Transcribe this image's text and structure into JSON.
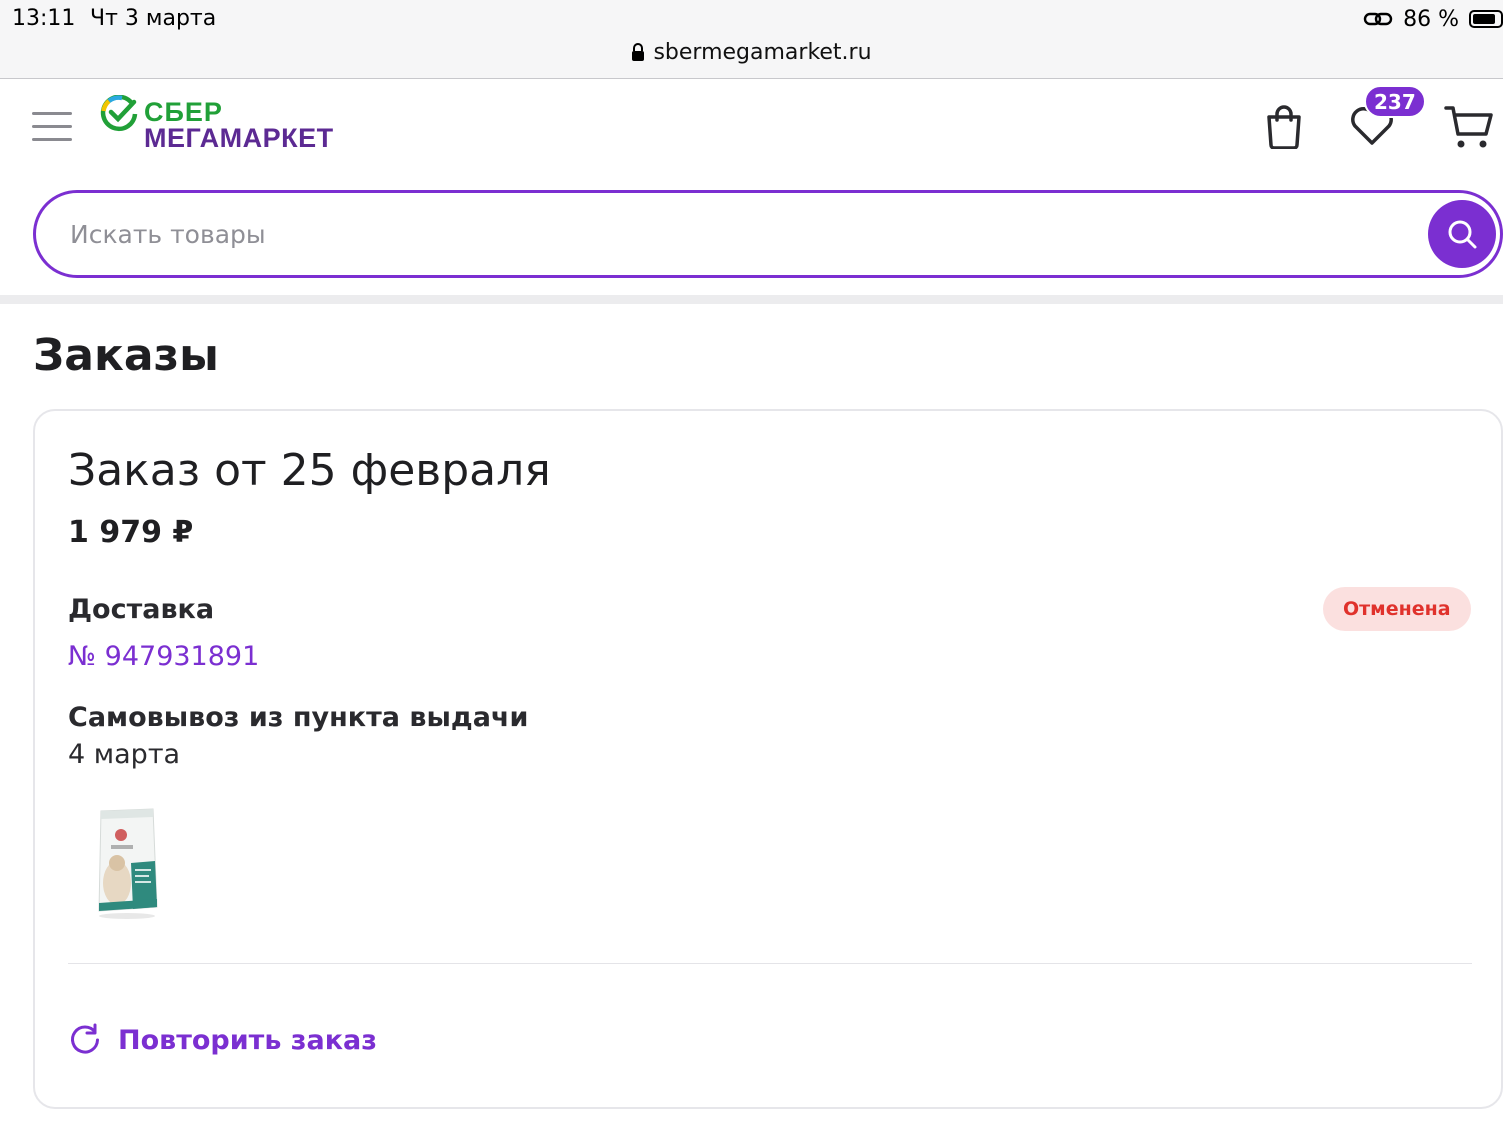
{
  "status_bar": {
    "time": "13:11",
    "date": "Чт 3 марта",
    "battery": "86 %",
    "battery_level": 0.86
  },
  "browser": {
    "url": "sbermegamarket.ru"
  },
  "header": {
    "logo_line1": "СБЕР",
    "logo_line2": "МЕГАМАРКЕТ",
    "favorites_count": "237",
    "icons": [
      "menu-icon",
      "shopping-bag-icon",
      "heart-icon",
      "cart-icon"
    ]
  },
  "search": {
    "placeholder": "Искать товары",
    "value": ""
  },
  "page": {
    "title": "Заказы"
  },
  "order": {
    "title": "Заказ от 25 февраля",
    "total": "1 979 ₽",
    "delivery_label": "Доставка",
    "delivery_number": "№ 947931891",
    "status": "Отменена",
    "pickup_label": "Самовывоз из пункта выдачи",
    "pickup_date": "4 марта",
    "repeat_label": "Повторить заказ"
  },
  "colors": {
    "accent": "#7b2fd1",
    "sber_green": "#21a038",
    "mega_purple": "#5c2a93",
    "status_red": "#e0322c",
    "status_bg": "#fbe0df"
  }
}
